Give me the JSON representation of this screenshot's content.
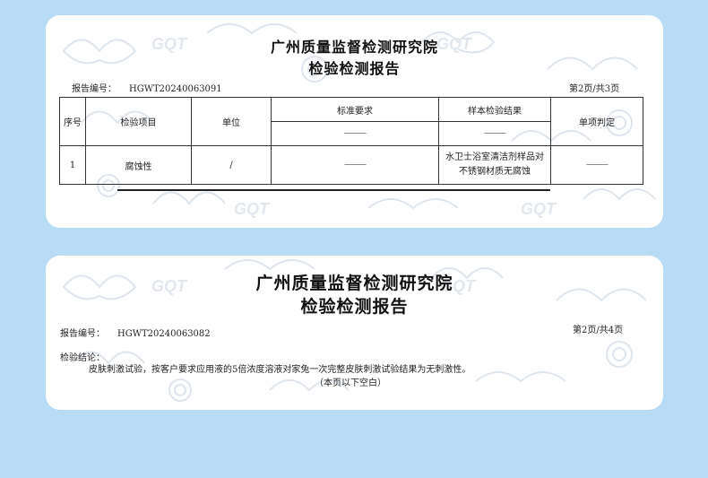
{
  "colors": {
    "page_bg": "#b9dcf6",
    "card_bg": "#ffffff",
    "watermark": "#d8e0e8"
  },
  "watermark_text": "GQT",
  "card1": {
    "title_line1": "广州质量监督检测研究院",
    "title_line2": "检验检测报告",
    "report_no_label": "报告编号：",
    "report_no": "HGWT20240063091",
    "page_info": "第2页/共3页",
    "table": {
      "headers": {
        "seq": "序号",
        "item": "检验项目",
        "unit": "单位",
        "standard": "标准要求",
        "sample_result": "样本检验结果",
        "judgement": "单项判定"
      },
      "subheader_standard": "———",
      "subheader_result": "———",
      "rows": [
        {
          "seq": "1",
          "item": "腐蚀性",
          "unit": "/",
          "standard": "———",
          "result_line1": "水卫士浴室清洁剂样品对",
          "result_line2": "不锈钢材质无腐蚀",
          "judgement": "———"
        }
      ]
    }
  },
  "card2": {
    "title_line1": "广州质量监督检测研究院",
    "title_line2": "检验检测报告",
    "report_no_label": "报告编号：",
    "report_no": "HGWT20240063082",
    "page_info": "第2页/共4页",
    "conclusion_label": "检验结论：",
    "conclusion_text": "皮肤刺激试验，按客户要求应用液的5倍浓度溶液对家兔一次完整皮肤刺激试验结果为无刺激性。",
    "blank_note": "（本页以下空白）"
  }
}
